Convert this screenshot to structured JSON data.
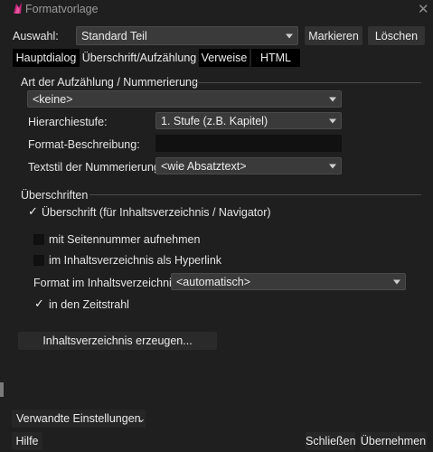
{
  "window": {
    "title": "Formatvorlage"
  },
  "top": {
    "auswahl_label": "Auswahl:",
    "auswahl_value": "Standard Teil",
    "markieren": "Markieren",
    "loeschen": "Löschen"
  },
  "tabs": [
    {
      "label": "Hauptdialog"
    },
    {
      "label": "Überschrift/Aufzählung"
    },
    {
      "label": "Verweise"
    },
    {
      "label": "HTML"
    }
  ],
  "numbering": {
    "section_title": "Art der Aufzählung / Nummerierung",
    "type_value": "<keine>",
    "level_label": "Hierarchiestufe:",
    "level_value": "1. Stufe (z.B. Kapitel)",
    "format_label": "Format-Beschreibung:",
    "format_value": "",
    "textstyle_label": "Textstil der Nummerierung:",
    "textstyle_value": "<wie Absatztext>"
  },
  "headings": {
    "section_title": "Überschriften",
    "heading_check_label": "Überschrift (für Inhaltsverzeichnis / Navigator)",
    "heading_checked": true,
    "pagenum_label": "mit Seitennummer aufnehmen",
    "pagenum_checked": false,
    "hyperlink_label": "im Inhaltsverzeichnis als Hyperlink",
    "hyperlink_checked": false,
    "toc_format_label": "Format im Inhaltsverzeichnis:",
    "toc_format_value": "<automatisch>",
    "timeline_label": "in den Zeitstrahl",
    "timeline_checked": true,
    "generate_toc": "Inhaltsverzeichnis erzeugen..."
  },
  "bottom": {
    "related": "Verwandte Einstellungen",
    "help": "Hilfe",
    "close": "Schließen",
    "apply": "Übernehmen"
  },
  "colors": {
    "background": "#1f1f1f",
    "field": "#3a3a3a",
    "button": "#323232",
    "icon_accent": "#c0267a"
  }
}
